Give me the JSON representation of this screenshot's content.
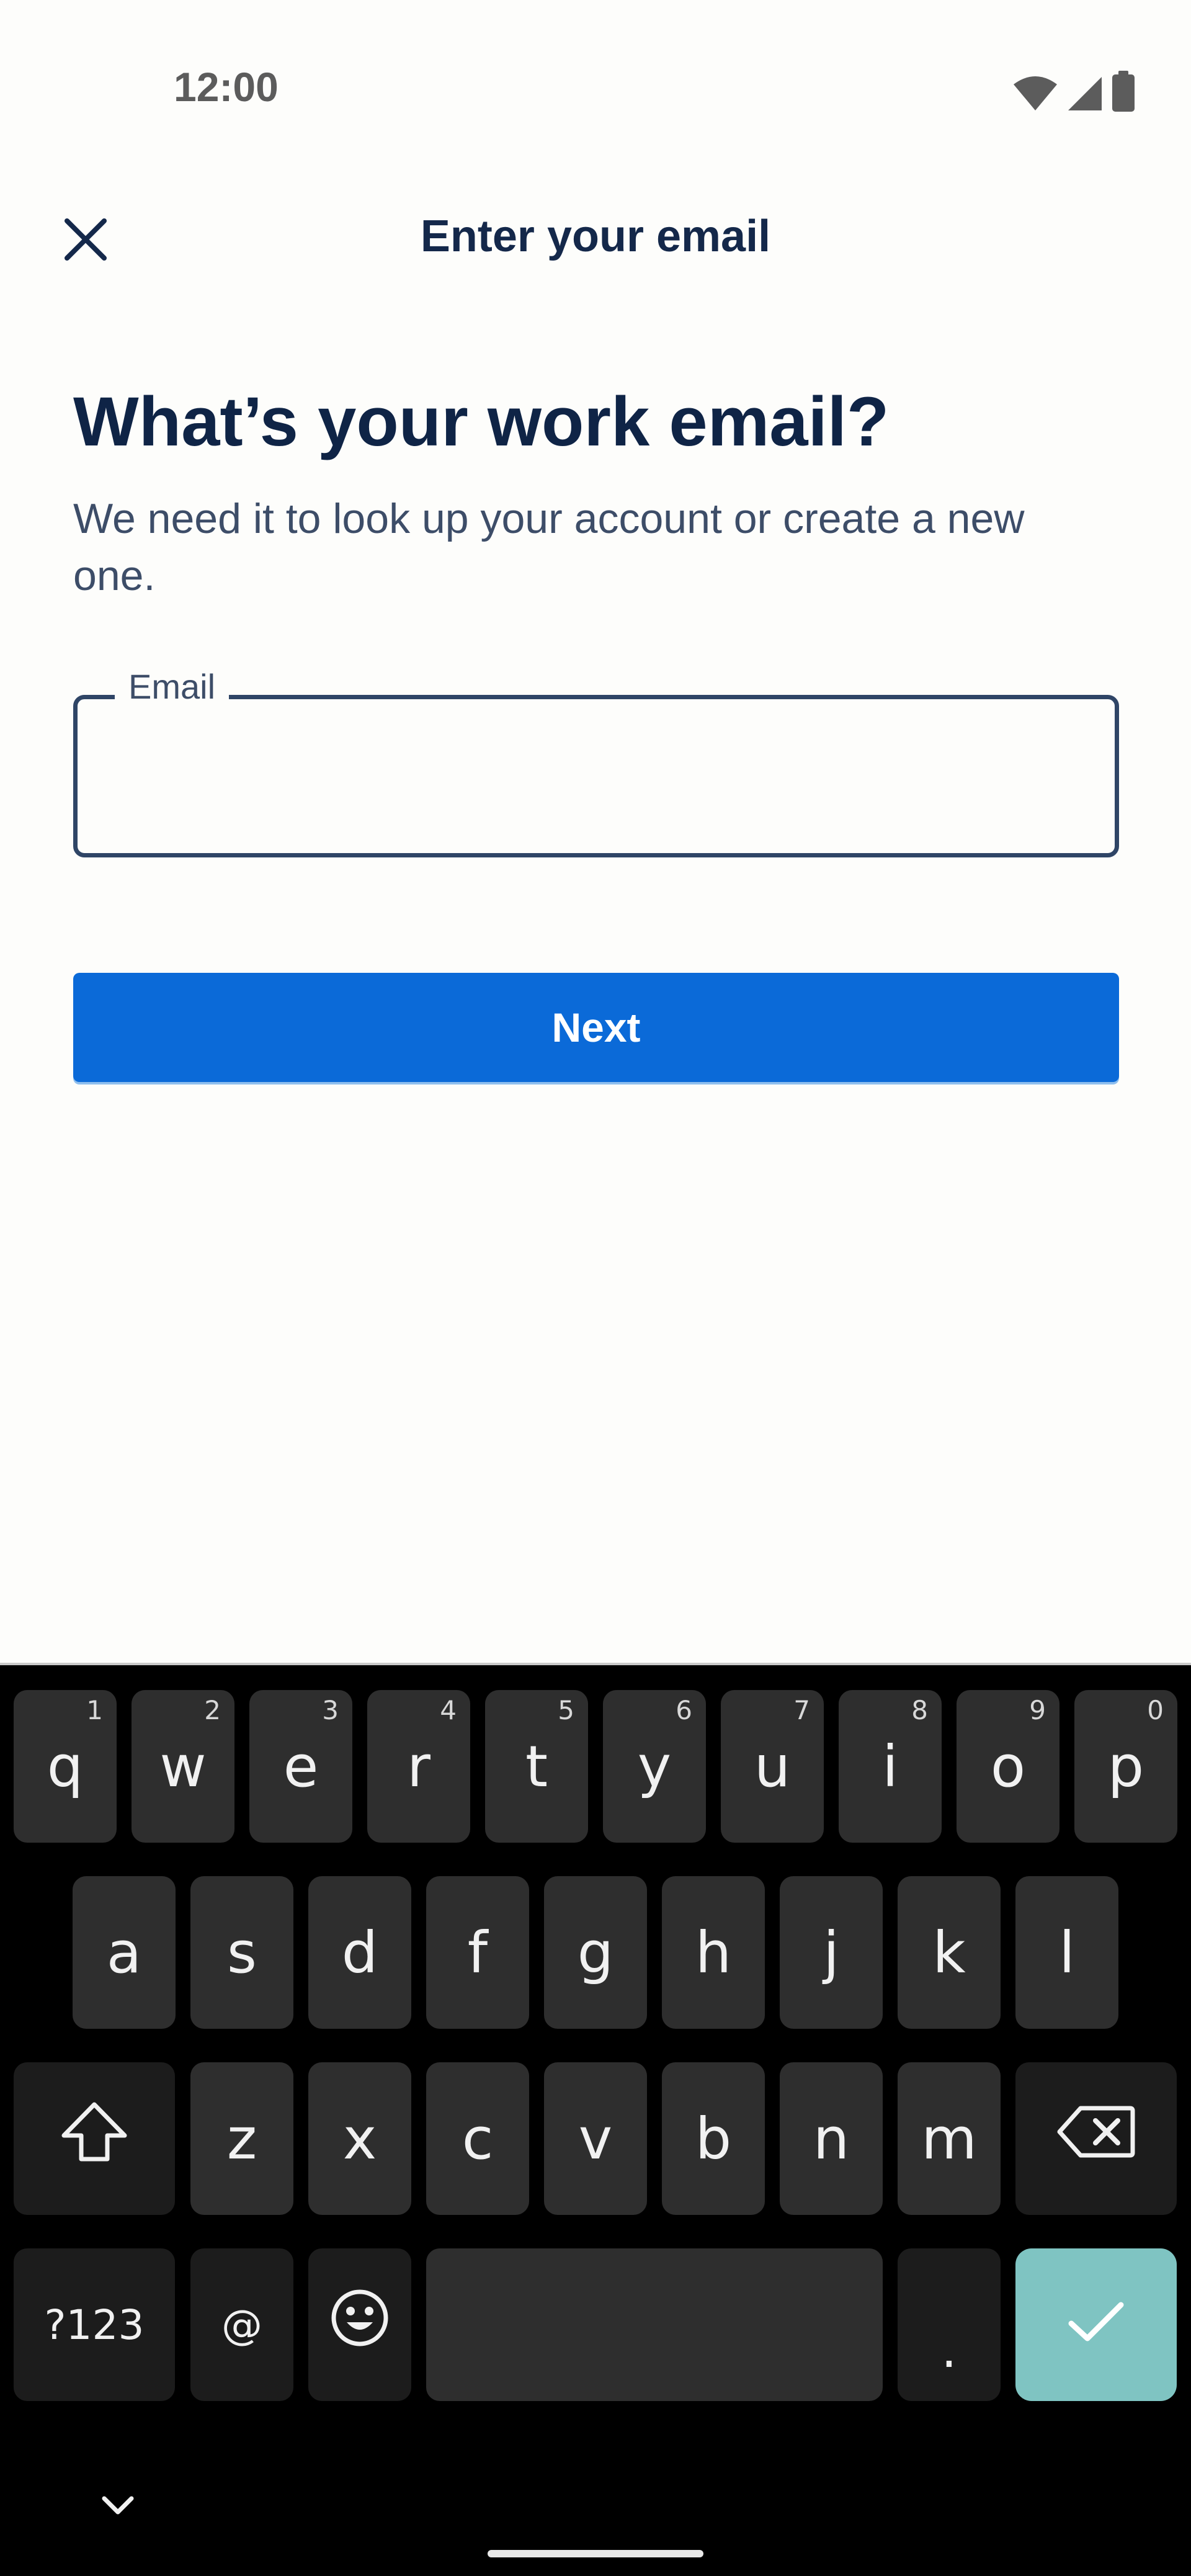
{
  "status_bar": {
    "time": "12:00",
    "icons": [
      "wifi-icon",
      "cellular-signal-icon",
      "battery-icon"
    ]
  },
  "app_bar": {
    "close_icon": "close-icon",
    "title": "Enter your email"
  },
  "content": {
    "heading": "What’s your work email?",
    "subtitle": "We need it to look up your account or create a new one.",
    "email_field": {
      "label": "Email",
      "value": "",
      "placeholder": ""
    },
    "next_button": "Next"
  },
  "keyboard": {
    "row1": [
      {
        "label": "q",
        "hint": "1"
      },
      {
        "label": "w",
        "hint": "2"
      },
      {
        "label": "e",
        "hint": "3"
      },
      {
        "label": "r",
        "hint": "4"
      },
      {
        "label": "t",
        "hint": "5"
      },
      {
        "label": "y",
        "hint": "6"
      },
      {
        "label": "u",
        "hint": "7"
      },
      {
        "label": "i",
        "hint": "8"
      },
      {
        "label": "o",
        "hint": "9"
      },
      {
        "label": "p",
        "hint": "0"
      }
    ],
    "row2": [
      "a",
      "s",
      "d",
      "f",
      "g",
      "h",
      "j",
      "k",
      "l"
    ],
    "row3": [
      "z",
      "x",
      "c",
      "v",
      "b",
      "n",
      "m"
    ],
    "shift_icon": "shift-icon",
    "backspace_icon": "backspace-icon",
    "symbols_key": "?123",
    "at_key": "@",
    "emoji_icon": "emoji-icon",
    "period_key": ".",
    "enter_icon": "checkmark-icon"
  },
  "nav_bar": {
    "chevron_icon": "chevron-down-icon"
  },
  "colors": {
    "primary": "#0b6ad8",
    "heading_text": "#0f2446",
    "keyboard_bg": "#000000",
    "key_bg": "#2e2e2e",
    "enter_key_bg": "#7fc4c2"
  }
}
